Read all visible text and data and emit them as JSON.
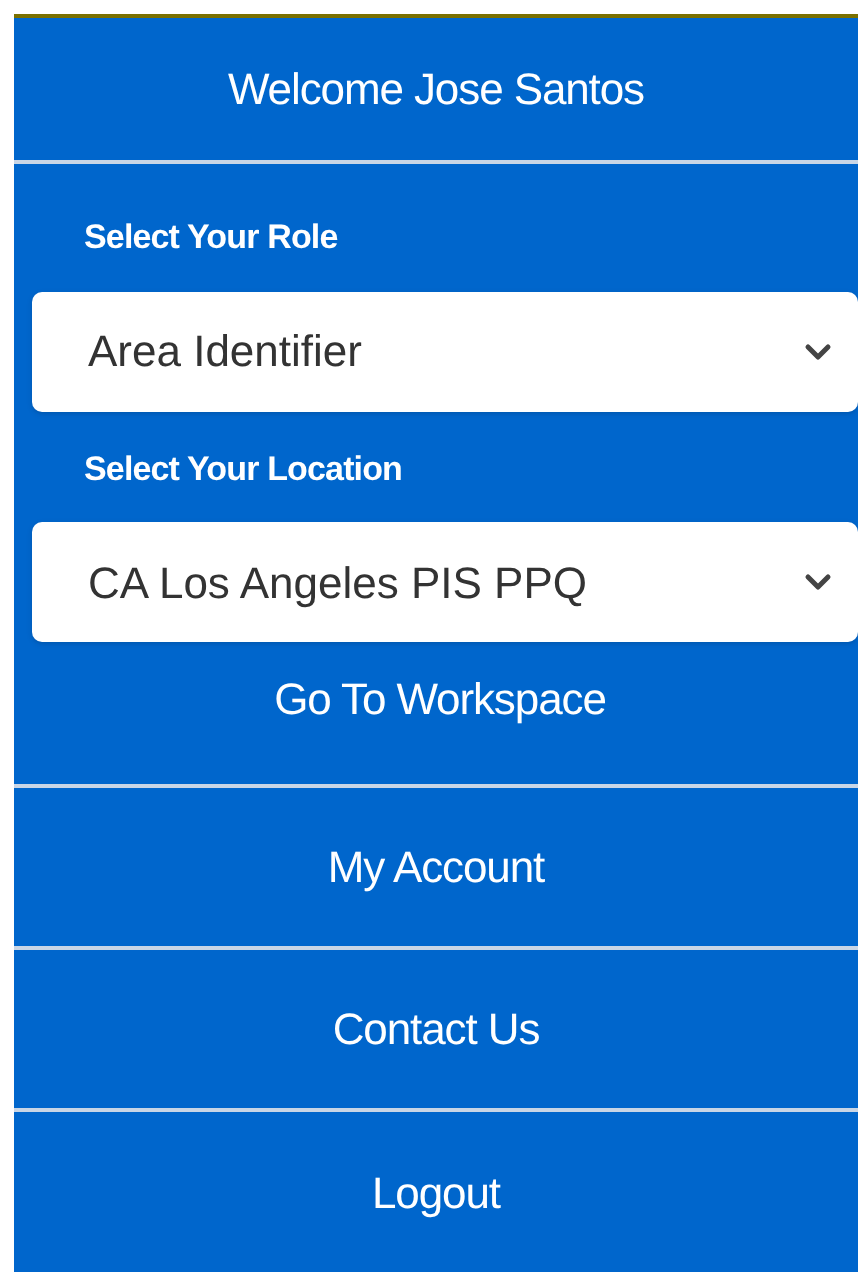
{
  "header": {
    "title": "Welcome Jose Santos"
  },
  "form": {
    "fields": [
      {
        "label": "Select Your Role",
        "value": "Area Identifier"
      },
      {
        "label": "Select Your Location",
        "value": "CA Los Angeles PIS PPQ"
      }
    ],
    "action": "Go To Workspace"
  },
  "menu": [
    "My Account",
    "Contact Us",
    "Logout"
  ]
}
